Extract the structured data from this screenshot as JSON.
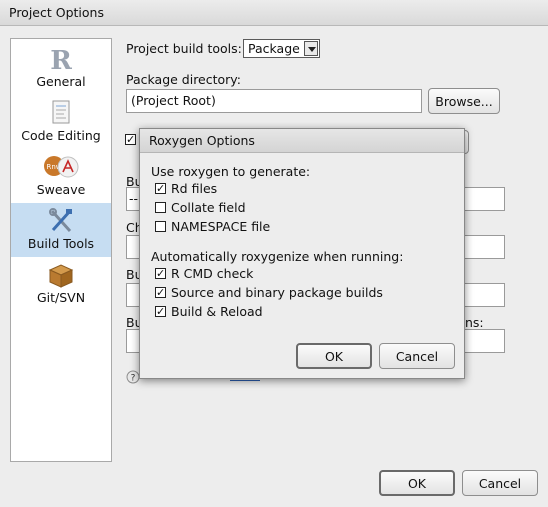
{
  "window": {
    "title": "Project Options"
  },
  "sidebar": {
    "items": [
      {
        "label": "General",
        "icon": "r-logo-icon",
        "selected": false
      },
      {
        "label": "Code Editing",
        "icon": "document-icon",
        "selected": false
      },
      {
        "label": "Sweave",
        "icon": "sweave-icon",
        "selected": false
      },
      {
        "label": "Build Tools",
        "icon": "build-tools-icon",
        "selected": true
      },
      {
        "label": "Git/SVN",
        "icon": "package-box-icon",
        "selected": false
      }
    ]
  },
  "main": {
    "build_tools_label": "Project build tools:",
    "build_tools_value": "Package",
    "package_dir_label": "Package directory:",
    "package_dir_value": "(Project Root)",
    "browse_label": "Browse...",
    "partial_labels": [
      "Bu",
      "Ch",
      "Bu",
      "Bu"
    ],
    "options_tail": "ns:",
    "field_value_fragment": "--"
  },
  "dialog": {
    "title": "Roxygen Options",
    "generate_heading": "Use roxygen to generate:",
    "generate_options": [
      {
        "label": "Rd files",
        "checked": true
      },
      {
        "label": "Collate field",
        "checked": false
      },
      {
        "label": "NAMESPACE file",
        "checked": false
      }
    ],
    "auto_heading": "Automatically roxygenize when running:",
    "auto_options": [
      {
        "label": "R CMD check",
        "checked": true
      },
      {
        "label": "Source and binary package builds",
        "checked": true
      },
      {
        "label": "Build & Reload",
        "checked": true
      }
    ],
    "ok_label": "OK",
    "cancel_label": "Cancel"
  },
  "footer": {
    "ok_label": "OK",
    "cancel_label": "Cancel"
  }
}
